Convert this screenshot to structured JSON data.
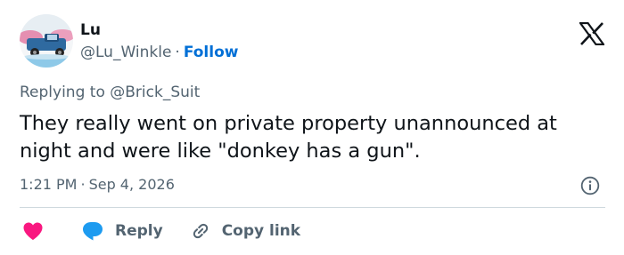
{
  "author": {
    "name": "Lu",
    "handle": "@Lu_Winkle",
    "separator": "·",
    "follow_label": "Follow",
    "avatar_icon": "truck-avatar"
  },
  "brand_icon": "x-logo-icon",
  "reply_context": {
    "prefix": "Replying to",
    "target": "@Brick_Suit"
  },
  "tweet": {
    "text": "They really went on private property unannounced at night and were like \"donkey has a gun\".",
    "time": "1:21 PM",
    "separator": "·",
    "date": "Sep 4, 2026"
  },
  "actions": {
    "like_icon": "heart-icon",
    "reply_icon": "speech-bubble-icon",
    "reply_label": "Reply",
    "copy_icon": "link-icon",
    "copy_label": "Copy link",
    "info_icon": "info-icon"
  },
  "colors": {
    "link_blue": "#006fd6",
    "heart_red": "#f91880",
    "reply_blue": "#1d9bf0",
    "secondary_text": "#536471",
    "divider": "#cfd9de"
  }
}
